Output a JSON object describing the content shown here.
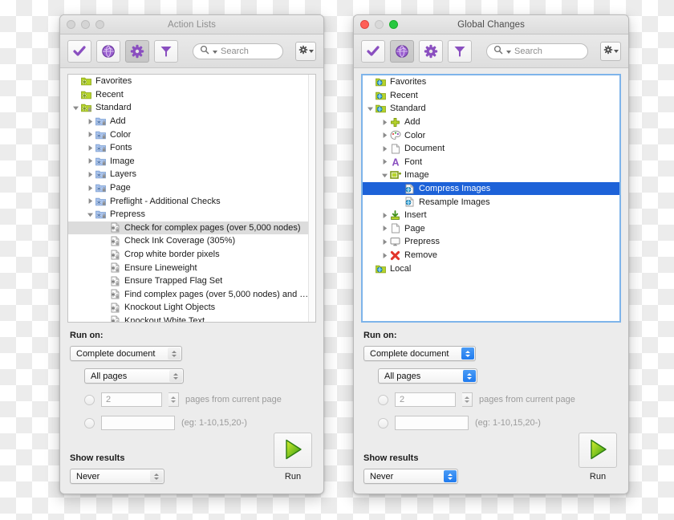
{
  "windows": [
    {
      "id": "left",
      "title": "Action Lists",
      "active": false,
      "toolbar": {
        "buttons": [
          {
            "name": "check-icon",
            "label": "Check",
            "selected": false
          },
          {
            "name": "globe-icon",
            "label": "Global Changes",
            "selected": false
          },
          {
            "name": "gear-icon",
            "label": "Action Lists",
            "selected": true
          },
          {
            "name": "funnel-icon",
            "label": "Filter",
            "selected": false
          }
        ],
        "search_placeholder": "Search",
        "settings_label": "Settings"
      },
      "tree": [
        {
          "label": "Favorites",
          "depth": 0,
          "icon": "folder-gear-green",
          "twisty": "none",
          "selected": false
        },
        {
          "label": "Recent",
          "depth": 0,
          "icon": "folder-gear-green",
          "twisty": "none",
          "selected": false
        },
        {
          "label": "Standard",
          "depth": 0,
          "icon": "folder-gear-green-lock",
          "twisty": "open",
          "selected": false
        },
        {
          "label": "Add",
          "depth": 1,
          "icon": "folder-gear-blue-lock",
          "twisty": "closed",
          "selected": false
        },
        {
          "label": "Color",
          "depth": 1,
          "icon": "folder-gear-blue-lock",
          "twisty": "closed",
          "selected": false
        },
        {
          "label": "Fonts",
          "depth": 1,
          "icon": "folder-gear-blue-lock",
          "twisty": "closed",
          "selected": false
        },
        {
          "label": "Image",
          "depth": 1,
          "icon": "folder-gear-blue-lock",
          "twisty": "closed",
          "selected": false
        },
        {
          "label": "Layers",
          "depth": 1,
          "icon": "folder-gear-blue-lock",
          "twisty": "closed",
          "selected": false
        },
        {
          "label": "Page",
          "depth": 1,
          "icon": "folder-gear-blue-lock",
          "twisty": "closed",
          "selected": false
        },
        {
          "label": "Preflight - Additional Checks",
          "depth": 1,
          "icon": "folder-gear-blue-lock",
          "twisty": "closed",
          "selected": false
        },
        {
          "label": "Prepress",
          "depth": 1,
          "icon": "folder-gear-blue-lock",
          "twisty": "open",
          "selected": false
        },
        {
          "label": "Check for complex pages (over 5,000 nodes)",
          "depth": 2,
          "icon": "doc-gear-lock",
          "twisty": "none",
          "selected": true
        },
        {
          "label": "Check Ink Coverage (305%)",
          "depth": 2,
          "icon": "doc-gear-lock",
          "twisty": "none",
          "selected": false
        },
        {
          "label": "Crop white border pixels",
          "depth": 2,
          "icon": "doc-gear-lock",
          "twisty": "none",
          "selected": false
        },
        {
          "label": "Ensure Lineweight",
          "depth": 2,
          "icon": "doc-gear-lock",
          "twisty": "none",
          "selected": false
        },
        {
          "label": "Ensure Trapped Flag Set",
          "depth": 2,
          "icon": "doc-gear-lock",
          "twisty": "none",
          "selected": false
        },
        {
          "label": "Find complex pages (over 5,000 nodes) and …",
          "depth": 2,
          "icon": "doc-gear-lock",
          "twisty": "none",
          "selected": false
        },
        {
          "label": "Knockout Light Objects",
          "depth": 2,
          "icon": "doc-gear-lock",
          "twisty": "none",
          "selected": false
        },
        {
          "label": "Knockout White Text",
          "depth": 2,
          "icon": "doc-gear-lock",
          "twisty": "none",
          "selected": false
        }
      ],
      "run_on": {
        "label": "Run on:",
        "scope_value": "Complete document",
        "pages_value": "All pages",
        "count_value": "2",
        "count_suffix": "pages from current page",
        "range_value": "",
        "range_hint": "(eg: 1-10,15,20-)"
      },
      "show_results": {
        "label": "Show results",
        "value": "Never"
      },
      "run": {
        "label": "Run",
        "icon": "play-triangle-green"
      }
    },
    {
      "id": "right",
      "title": "Global Changes",
      "active": true,
      "toolbar": {
        "buttons": [
          {
            "name": "check-icon",
            "label": "Check",
            "selected": false
          },
          {
            "name": "globe-icon",
            "label": "Global Changes",
            "selected": true
          },
          {
            "name": "gear-icon",
            "label": "Action Lists",
            "selected": false
          },
          {
            "name": "funnel-icon",
            "label": "Filter",
            "selected": false
          }
        ],
        "search_placeholder": "Search",
        "settings_label": "Settings"
      },
      "tree": [
        {
          "label": "Favorites",
          "depth": 0,
          "icon": "folder-globe-green",
          "twisty": "none",
          "selected": false
        },
        {
          "label": "Recent",
          "depth": 0,
          "icon": "folder-globe-green",
          "twisty": "none",
          "selected": false
        },
        {
          "label": "Standard",
          "depth": 0,
          "icon": "folder-globe-green",
          "twisty": "open",
          "selected": false
        },
        {
          "label": "Add",
          "depth": 1,
          "icon": "plus-green",
          "twisty": "closed",
          "selected": false
        },
        {
          "label": "Color",
          "depth": 1,
          "icon": "palette",
          "twisty": "closed",
          "selected": false
        },
        {
          "label": "Document",
          "depth": 1,
          "icon": "page-blank",
          "twisty": "closed",
          "selected": false
        },
        {
          "label": "Font",
          "depth": 1,
          "icon": "letter-a-purple",
          "twisty": "closed",
          "selected": false
        },
        {
          "label": "Image",
          "depth": 1,
          "icon": "image-frame-green",
          "twisty": "open",
          "selected": false
        },
        {
          "label": "Compress Images",
          "depth": 2,
          "icon": "doc-globe",
          "twisty": "none",
          "selected": true
        },
        {
          "label": "Resample Images",
          "depth": 2,
          "icon": "doc-globe",
          "twisty": "none",
          "selected": false
        },
        {
          "label": "Insert",
          "depth": 1,
          "icon": "insert-arrow-green",
          "twisty": "closed",
          "selected": false
        },
        {
          "label": "Page",
          "depth": 1,
          "icon": "page-blank",
          "twisty": "closed",
          "selected": false
        },
        {
          "label": "Prepress",
          "depth": 1,
          "icon": "monitor-gray",
          "twisty": "closed",
          "selected": false
        },
        {
          "label": "Remove",
          "depth": 1,
          "icon": "x-red",
          "twisty": "closed",
          "selected": false
        },
        {
          "label": "Local",
          "depth": 0,
          "icon": "folder-globe-green",
          "twisty": "none",
          "selected": false
        }
      ],
      "run_on": {
        "label": "Run on:",
        "scope_value": "Complete document",
        "pages_value": "All pages",
        "count_value": "2",
        "count_suffix": "pages from current page",
        "range_value": "",
        "range_hint": "(eg: 1-10,15,20-)"
      },
      "show_results": {
        "label": "Show results",
        "value": "Never"
      },
      "run": {
        "label": "Run",
        "icon": "play-triangle-green"
      }
    }
  ],
  "colors": {
    "toolbar_icon": "#8a4fc0",
    "selection_blue": "#1d62d8",
    "selection_gray": "#dcdcdc",
    "run_green": "#4caf17",
    "window_bg": "#ececec"
  }
}
